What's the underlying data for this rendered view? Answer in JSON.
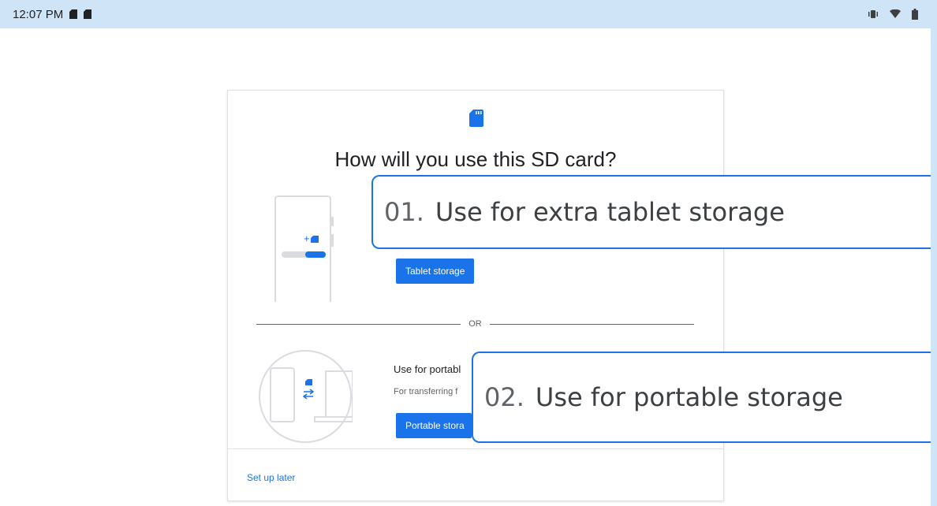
{
  "status_bar": {
    "time": "12:07 PM",
    "left_icons": [
      "sd-card-icon",
      "sd-card-icon"
    ],
    "right_icons": [
      "vibrate-icon",
      "wifi-icon",
      "battery-icon"
    ]
  },
  "dialog": {
    "icon": "sd-card-icon",
    "title": "How will you use this SD card?",
    "option1": {
      "button_label": "Tablet storage"
    },
    "divider_label": "OR",
    "option2": {
      "title": "Use for portabl",
      "description": "For transferring f",
      "button_label": "Portable stora"
    },
    "setup_later": "Set up later"
  },
  "callouts": [
    {
      "number": "01.",
      "text": "Use for extra tablet storage"
    },
    {
      "number": "02.",
      "text": "Use for portable storage"
    }
  ],
  "colors": {
    "accent": "#1a73e8",
    "background": "#cfe4f7"
  }
}
